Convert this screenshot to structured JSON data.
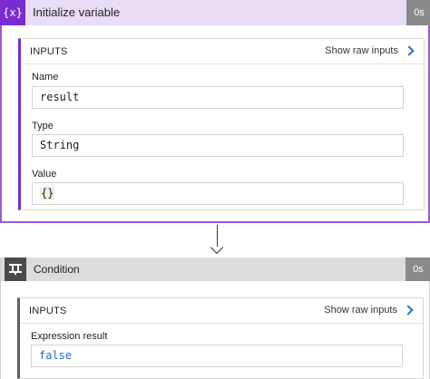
{
  "init_card": {
    "icon_text": "{x}",
    "title": "Initialize variable",
    "duration": "0s",
    "inputs": {
      "title": "INPUTS",
      "raw_label": "Show raw inputs",
      "name_label": "Name",
      "name_value": "result",
      "type_label": "Type",
      "type_value": "String",
      "value_label": "Value",
      "value_value": "{}"
    }
  },
  "condition_card": {
    "title": "Condition",
    "duration": "0s",
    "inputs": {
      "title": "INPUTS",
      "raw_label": "Show raw inputs",
      "expr_label": "Expression result",
      "expr_value": "false"
    }
  },
  "colors": {
    "init_accent": "#7a2bd1",
    "init_header": "#e9dcf5",
    "condition_header": "#dcdcdc",
    "link": "#1f6fd1"
  },
  "icons": [
    "variable-icon",
    "chevron-right-icon",
    "condition-icon",
    "arrow-down-icon"
  ]
}
